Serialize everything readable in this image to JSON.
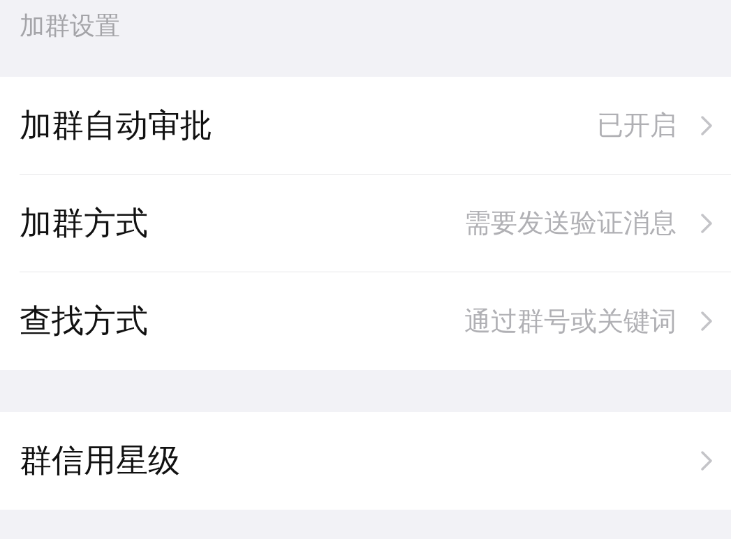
{
  "section_header": "加群设置",
  "groups": [
    {
      "rows": [
        {
          "label": "加群自动审批",
          "value": "已开启"
        },
        {
          "label": "加群方式",
          "value": "需要发送验证消息"
        },
        {
          "label": "查找方式",
          "value": "通过群号或关键词"
        }
      ]
    },
    {
      "rows": [
        {
          "label": "群信用星级"
        }
      ]
    }
  ]
}
